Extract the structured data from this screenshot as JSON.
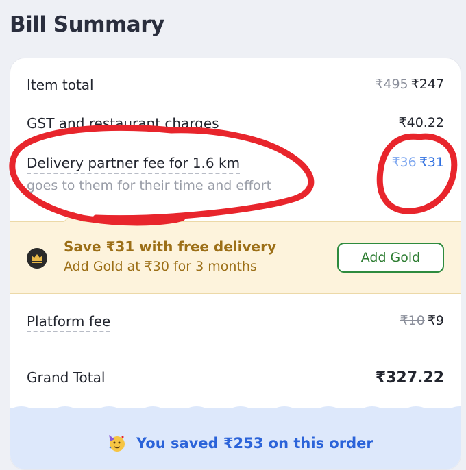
{
  "header": {
    "title": "Bill Summary"
  },
  "bill": {
    "item_total": {
      "label": "Item total",
      "original": "₹495",
      "price": "₹247"
    },
    "gst": {
      "label": "GST and restaurant charges",
      "price": "₹40.22"
    },
    "delivery": {
      "label": "Delivery partner fee for 1.6 km",
      "sub": "goes to them for their time and effort",
      "original": "₹36",
      "price": "₹31"
    },
    "platform": {
      "label": "Platform fee",
      "original": "₹10",
      "price": "₹9"
    },
    "grand_total": {
      "label": "Grand Total",
      "price": "₹327.22"
    }
  },
  "gold": {
    "title": "Save ₹31 with free delivery",
    "subtitle": "Add Gold at ₹30 for 3 months",
    "button": "Add Gold",
    "icon": "crown-icon"
  },
  "savings": {
    "text": "You saved ₹253 on this order",
    "icon": "party-face-icon"
  },
  "colors": {
    "accent_blue": "#2f6fe0",
    "gold_text": "#9c6f17",
    "button_green": "#2e7d32",
    "annotation_red": "#e8252c"
  }
}
